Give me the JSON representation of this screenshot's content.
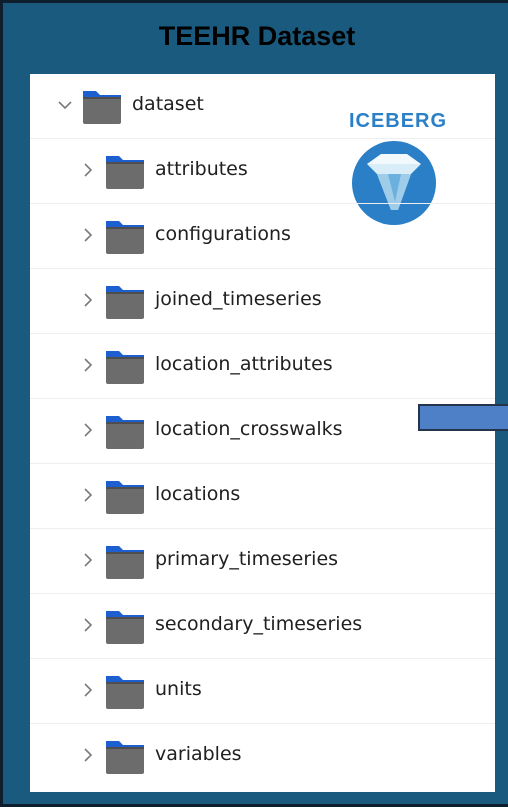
{
  "header": {
    "title": "TEEHR Dataset"
  },
  "badge": {
    "label": "ICEBERG",
    "icon": "iceberg-logo-icon"
  },
  "colors": {
    "frame": "#1a5a7e",
    "folder_tab": "#1d5fcf",
    "folder_body": "#6c6c6c",
    "iceberg_blue": "#2a7fc6",
    "connector": "#4d80c6"
  },
  "tree": {
    "root": {
      "label": "dataset",
      "expanded": true,
      "icon": "folder-icon"
    },
    "children": [
      {
        "label": "attributes"
      },
      {
        "label": "configurations"
      },
      {
        "label": "joined_timeseries"
      },
      {
        "label": "location_attributes"
      },
      {
        "label": "location_crosswalks"
      },
      {
        "label": "locations"
      },
      {
        "label": "primary_timeseries"
      },
      {
        "label": "secondary_timeseries"
      },
      {
        "label": "units"
      },
      {
        "label": "variables"
      }
    ]
  }
}
